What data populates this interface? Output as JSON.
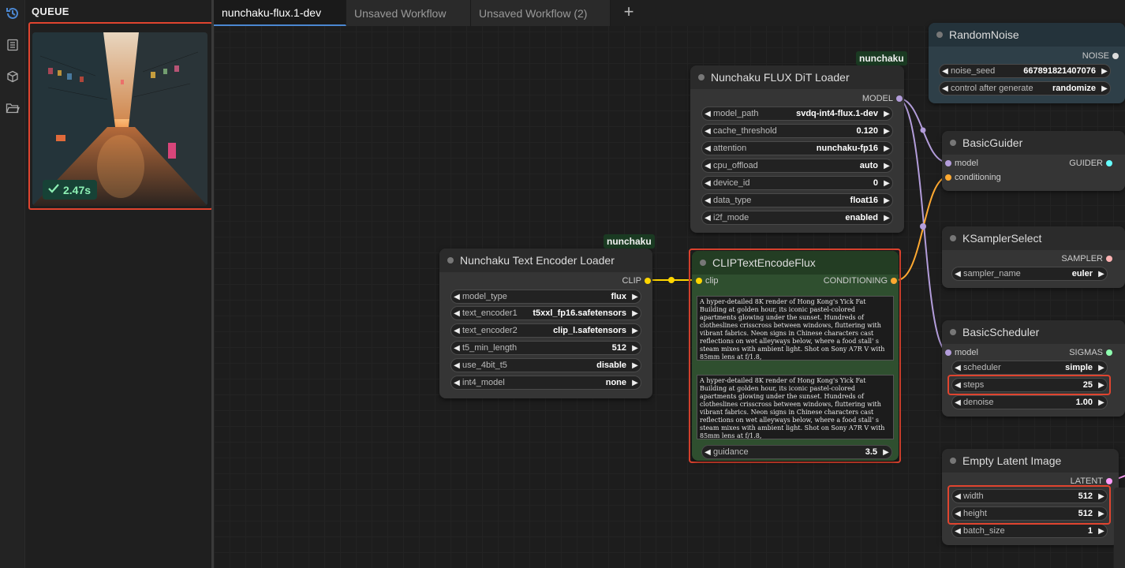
{
  "queue": {
    "title": "QUEUE",
    "items": [
      {
        "duration": "2.47s"
      }
    ]
  },
  "tabs": [
    {
      "label": "nunchaku-flux.1-dev"
    },
    {
      "label": "Unsaved Workflow"
    },
    {
      "label": "Unsaved Workflow (2)"
    }
  ],
  "tab_add_label": "+",
  "nodes": {
    "dit_loader": {
      "badge": "nunchaku",
      "title": "Nunchaku FLUX DiT Loader",
      "output": "MODEL",
      "widgets": [
        {
          "label": "model_path",
          "value": "svdq-int4-flux.1-dev"
        },
        {
          "label": "cache_threshold",
          "value": "0.120"
        },
        {
          "label": "attention",
          "value": "nunchaku-fp16"
        },
        {
          "label": "cpu_offload",
          "value": "auto"
        },
        {
          "label": "device_id",
          "value": "0"
        },
        {
          "label": "data_type",
          "value": "float16"
        },
        {
          "label": "i2f_mode",
          "value": "enabled"
        }
      ]
    },
    "text_encoder": {
      "badge": "nunchaku",
      "title": "Nunchaku Text Encoder Loader",
      "output": "CLIP",
      "widgets": [
        {
          "label": "model_type",
          "value": "flux"
        },
        {
          "label": "text_encoder1",
          "value": "t5xxl_fp16.safetensors"
        },
        {
          "label": "text_encoder2",
          "value": "clip_l.safetensors"
        },
        {
          "label": "t5_min_length",
          "value": "512"
        },
        {
          "label": "use_4bit_t5",
          "value": "disable"
        },
        {
          "label": "int4_model",
          "value": "none"
        }
      ]
    },
    "clip_encode": {
      "title": "CLIPTextEncodeFlux",
      "input": "clip",
      "output": "CONDITIONING",
      "prompt1": "A hyper-detailed 8K render of Hong Kong's Yick Fat Building at golden hour, its iconic pastel-colored apartments glowing under the sunset. Hundreds of clotheslines crisscross between windows, fluttering with vibrant fabrics. Neon signs in Chinese characters cast reflections on wet alleyways below, where a food stall' s steam mixes with ambient light. Shot on Sony A7R V with 85mm lens at f/1.8,",
      "prompt2": "A hyper-detailed 8K render of Hong Kong's Yick Fat Building at golden hour, its iconic pastel-colored apartments glowing under the sunset. Hundreds of clotheslines crisscross between windows, fluttering with vibrant fabrics. Neon signs in Chinese characters cast reflections on wet alleyways below, where a food stall' s steam mixes with ambient light. Shot on Sony A7R V with 85mm lens at f/1.8,",
      "widgets": [
        {
          "label": "guidance",
          "value": "3.5"
        }
      ]
    },
    "random_noise": {
      "title": "RandomNoise",
      "output": "NOISE",
      "widgets": [
        {
          "label": "noise_seed",
          "value": "667891821407076"
        },
        {
          "label": "control after generate",
          "value": "randomize"
        }
      ]
    },
    "basic_guider": {
      "title": "BasicGuider",
      "inputs": [
        "model",
        "conditioning"
      ],
      "output": "GUIDER"
    },
    "ksampler_select": {
      "title": "KSamplerSelect",
      "output": "SAMPLER",
      "widgets": [
        {
          "label": "sampler_name",
          "value": "euler"
        }
      ]
    },
    "basic_scheduler": {
      "title": "BasicScheduler",
      "input": "model",
      "output": "SIGMAS",
      "widgets": [
        {
          "label": "scheduler",
          "value": "simple"
        },
        {
          "label": "steps",
          "value": "25"
        },
        {
          "label": "denoise",
          "value": "1.00"
        }
      ]
    },
    "empty_latent": {
      "title": "Empty Latent Image",
      "output": "LATENT",
      "widgets": [
        {
          "label": "width",
          "value": "512"
        },
        {
          "label": "height",
          "value": "512"
        },
        {
          "label": "batch_size",
          "value": "1"
        }
      ]
    }
  },
  "colors": {
    "highlight": "#e0442f",
    "model_port": "#b39ddb",
    "clip_port": "#ffd500",
    "conditioning_port": "#ffa931",
    "guider_port": "#66ffff",
    "success_badge": "#174236"
  },
  "icons": [
    "history-icon",
    "list-icon",
    "cube-icon",
    "folder-icon",
    "check-icon",
    "plus-icon",
    "arrow-left-icon",
    "arrow-right-icon"
  ]
}
